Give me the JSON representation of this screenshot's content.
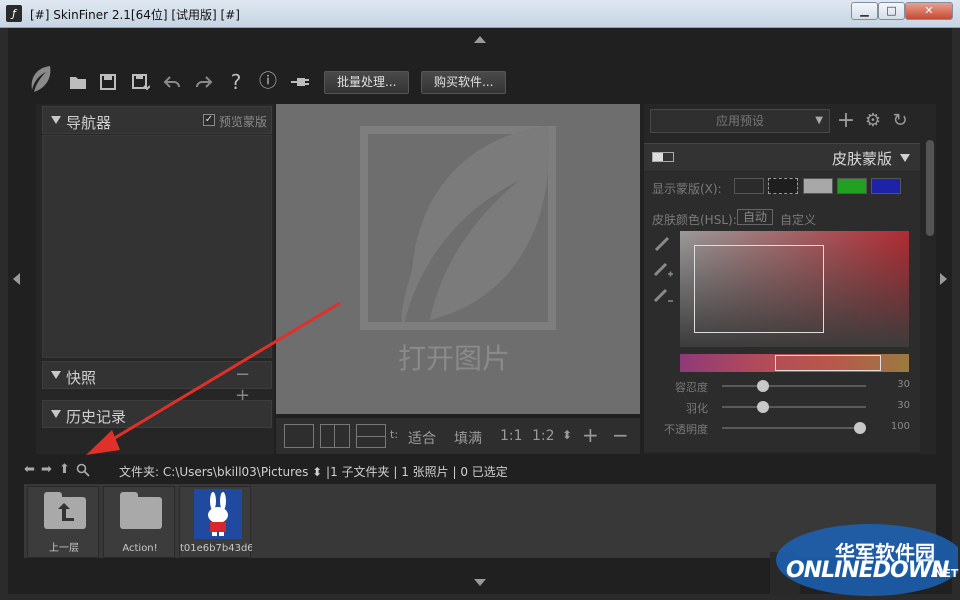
{
  "window": {
    "title": "[#] SkinFiner 2.1[64位] [试用版] [#]",
    "min_label": "▁",
    "max_label": "□",
    "close_label": "✕"
  },
  "toolbar": {
    "batch_label": "批量处理...",
    "buy_label": "购买软件...",
    "icons": [
      "open-folder-icon",
      "save-icon",
      "save-as-icon",
      "undo-icon",
      "redo-icon",
      "help-icon",
      "info-icon",
      "plugin-icon"
    ],
    "help_glyph": "?",
    "info_glyph": "ⓘ"
  },
  "left_panel": {
    "navigator_label": "导航器",
    "preview_mask_label": "预览蒙版",
    "snapshot_label": "快照",
    "snapshot_controls": "−+",
    "history_label": "历史记录"
  },
  "canvas": {
    "open_image_label": "打开图片",
    "fit_label": "适合",
    "fill_label": "填满",
    "ratio_1_label": "1:1",
    "ratio_2_label": "1:2",
    "truncated_label": "t:",
    "zoom_in": "+",
    "zoom_out": "−"
  },
  "right_panel": {
    "preset_placeholder": "应用预设",
    "skin_mask_title": "皮肤蒙版",
    "show_mask_label": "显示蒙版(X):",
    "swatch_colors": [
      "#2b2b2b",
      "#1e1e1e",
      "#a8a8a8",
      "#22a022",
      "#1e22a8"
    ],
    "skin_color_label": "皮肤颜色(HSL):",
    "auto_label": "自动",
    "custom_label": "自定义",
    "sliders": [
      {
        "label": "容忍度",
        "value": "30",
        "fraction": 0.3
      },
      {
        "label": "羽化",
        "value": "30",
        "fraction": 0.3
      },
      {
        "label": "不透明度",
        "value": "100",
        "fraction": 1.0
      }
    ]
  },
  "pathbar": {
    "text": "文件夹: C:\\Users\\bkill03\\Pictures ⬍ |1 子文件夹 | 1 张照片 | 0 已选定"
  },
  "browser": {
    "items": [
      {
        "caption": "上一层",
        "type": "folder-up"
      },
      {
        "caption": "Action!",
        "type": "folder"
      },
      {
        "caption": "t01e6b7b43d6...",
        "type": "image"
      }
    ]
  },
  "watermark": {
    "cn": "华军软件园",
    "en": "ONLINEDOWN",
    "net": ".NET"
  }
}
